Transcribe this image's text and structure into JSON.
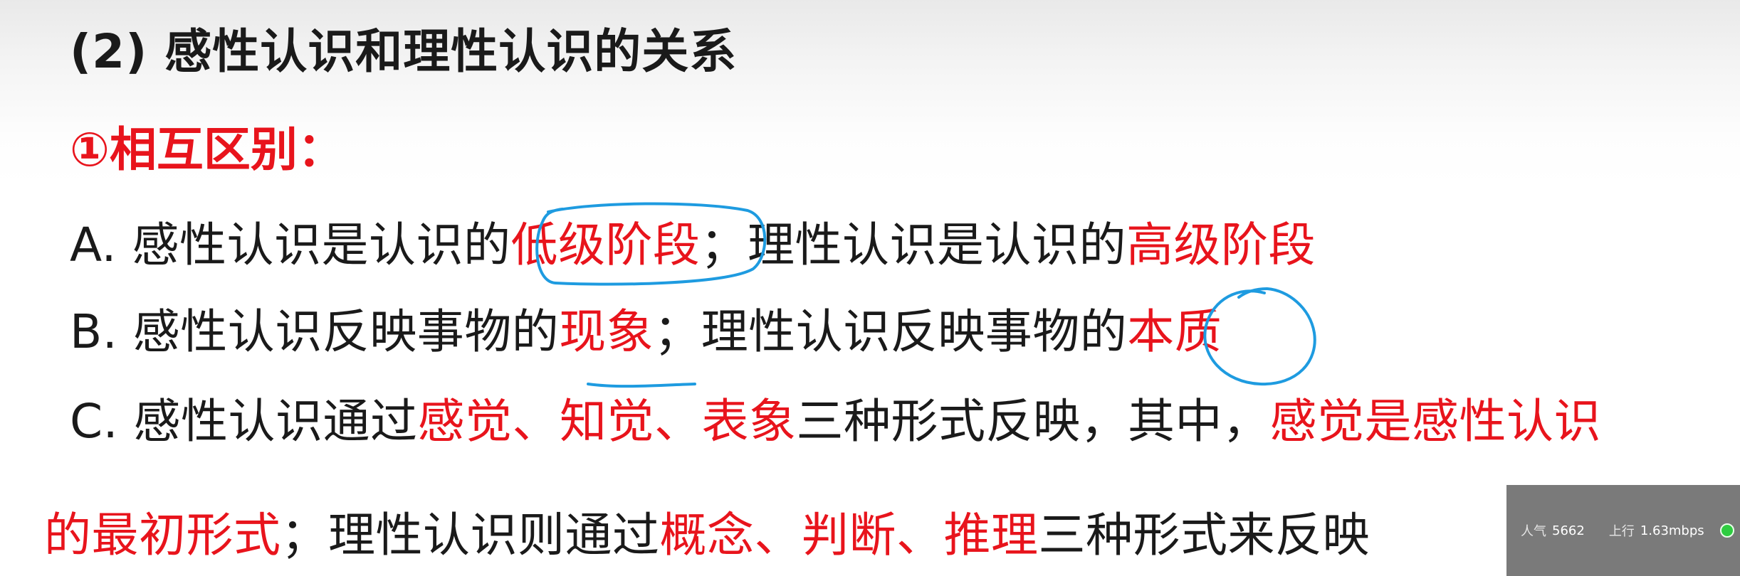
{
  "slide": {
    "title": "(2) 感性认识和理性认识的关系",
    "subtitle": "①相互区别：",
    "line_a": {
      "prefix": "A. 感性认识是认识的",
      "term1": "低级阶段",
      "middle": "；理性认识是认识的",
      "term2": "高级阶段"
    },
    "line_b": {
      "prefix": "B. 感性认识反映事物的",
      "term1": "现象",
      "middle": "；理性认识反映事物的",
      "term2": "本质"
    },
    "line_c": {
      "prefix": "C. 感性认识通过",
      "forms": "感觉、知觉、表象",
      "middle": "三种形式反映，其中，",
      "emphasis": "感觉是感性认识"
    },
    "line_d": {
      "emphasis": "的最初形式",
      "middle": "；理性认识则通过",
      "forms": "概念、判断、推理",
      "suffix": "三种形式来反映"
    }
  },
  "status_overlay": {
    "popularity_label": "人气",
    "popularity_value": "5662",
    "upload_label": "上行",
    "upload_value": "1.63mbps"
  },
  "colors": {
    "emphasis": "#e8141c",
    "text": "#1a1a1a",
    "annotation": "#1e9be0",
    "status_dot": "#2ecc40"
  }
}
